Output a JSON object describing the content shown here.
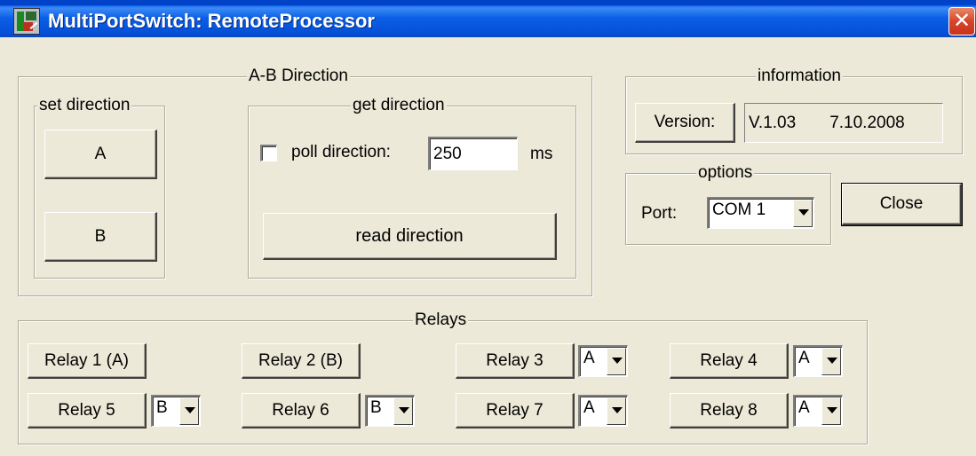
{
  "window": {
    "title": "MultiPortSwitch: RemoteProcessor",
    "icon": "app-icon",
    "close_icon": "close-x-icon"
  },
  "ab_direction": {
    "title": "A-B Direction",
    "set_direction": {
      "title": "set direction",
      "button_a": "A",
      "button_b": "B"
    },
    "get_direction": {
      "title": "get direction",
      "poll_label": "poll direction:",
      "poll_checked": false,
      "poll_value": "250",
      "poll_unit": "ms",
      "read_button": "read direction"
    }
  },
  "information": {
    "title": "information",
    "version_button": "Version:",
    "version": "V.1.03",
    "date": "7.10.2008"
  },
  "options": {
    "title": "options",
    "port_label": "Port:",
    "port_value": "COM 1"
  },
  "close_button": "Close",
  "relays": {
    "title": "Relays",
    "items": [
      {
        "label": "Relay 1 (A)"
      },
      {
        "label": "Relay 2 (B)"
      },
      {
        "label": "Relay 3",
        "select": "A"
      },
      {
        "label": "Relay 4",
        "select": "A"
      },
      {
        "label": "Relay 5",
        "select": "B"
      },
      {
        "label": "Relay 6",
        "select": "B"
      },
      {
        "label": "Relay 7",
        "select": "A"
      },
      {
        "label": "Relay 8",
        "select": "A"
      }
    ]
  }
}
